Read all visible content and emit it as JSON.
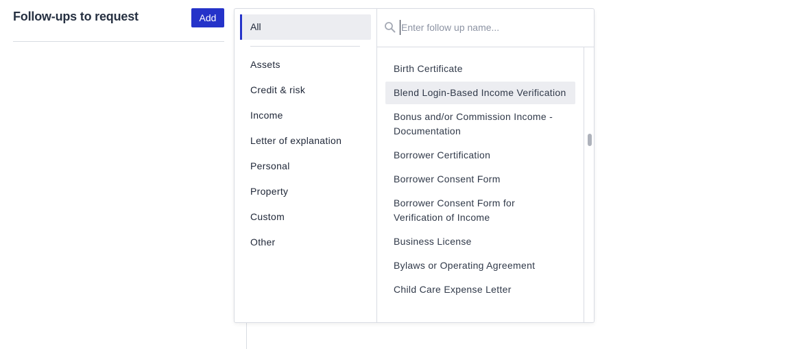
{
  "header": {
    "title": "Follow-ups to request",
    "add_label": "Add"
  },
  "categories": {
    "selected_label": "All",
    "items": [
      {
        "label": "Assets"
      },
      {
        "label": "Credit & risk"
      },
      {
        "label": "Income"
      },
      {
        "label": "Letter of explanation"
      },
      {
        "label": "Personal"
      },
      {
        "label": "Property"
      },
      {
        "label": "Custom"
      },
      {
        "label": "Other"
      }
    ]
  },
  "search": {
    "placeholder": "Enter follow up name...",
    "value": "",
    "icon": "search-icon"
  },
  "results": {
    "hovered_index": 1,
    "items": [
      {
        "label": "Birth Certificate"
      },
      {
        "label": "Blend Login-Based Income Verification"
      },
      {
        "label": "Bonus and/or Commission Income - Documentation"
      },
      {
        "label": "Borrower Certification"
      },
      {
        "label": "Borrower Consent Form"
      },
      {
        "label": "Borrower Consent Form for Verification of Income"
      },
      {
        "label": "Business License"
      },
      {
        "label": "Bylaws or Operating Agreement"
      },
      {
        "label": "Child Care Expense Letter"
      }
    ]
  },
  "colors": {
    "accent": "#2533c9",
    "selected_bg": "#ecedf1",
    "border": "#d8dbe2"
  }
}
